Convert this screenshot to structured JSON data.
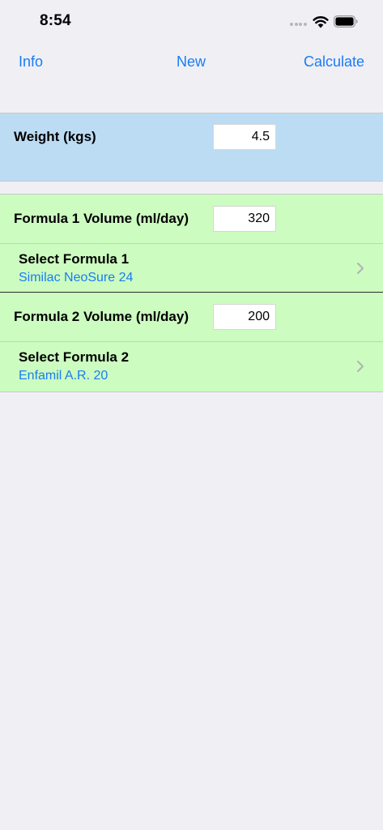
{
  "status_bar": {
    "time": "8:54",
    "icons": [
      "signal-dots-icon",
      "wifi-icon",
      "battery-icon"
    ]
  },
  "nav": {
    "info_label": "Info",
    "new_label": "New",
    "calculate_label": "Calculate"
  },
  "weight": {
    "label": "Weight (kgs)",
    "value": "4.5"
  },
  "formula1": {
    "volume_label": "Formula 1 Volume (ml/day)",
    "volume_value": "320",
    "select_label": "Select Formula 1",
    "selected": "Similac NeoSure 24"
  },
  "formula2": {
    "volume_label": "Formula 2 Volume (ml/day)",
    "volume_value": "200",
    "select_label": "Select Formula 2",
    "selected": "Enfamil A.R. 20"
  },
  "colors": {
    "accent": "#1a7cf5",
    "weight_bg": "#bcdcf4",
    "formula_bg": "#ccfcc0",
    "page_bg": "#efeff4"
  }
}
